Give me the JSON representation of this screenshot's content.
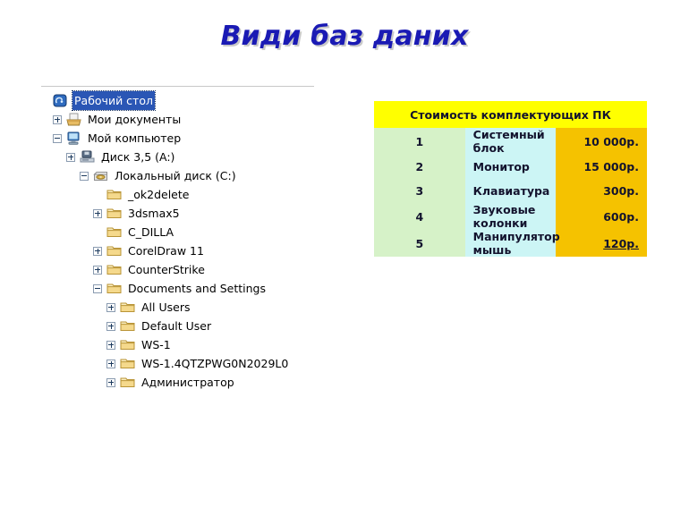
{
  "slide": {
    "title": "Види баз даних",
    "title_color": "#1a1ab4"
  },
  "explorer": {
    "name": "windows-explorer-folder-tree",
    "nodes": [
      {
        "label": "Рабочий стол",
        "level": 0,
        "toggle": "none",
        "icon": "desktop-icon",
        "selected": true
      },
      {
        "label": "Мои документы",
        "level": 1,
        "toggle": "plus",
        "icon": "my-documents-icon",
        "selected": false
      },
      {
        "label": "Мой компьютер",
        "level": 1,
        "toggle": "minus",
        "icon": "my-computer-icon",
        "selected": false
      },
      {
        "label": "Диск 3,5 (A:)",
        "level": 2,
        "toggle": "plus",
        "icon": "floppy-drive-icon",
        "selected": false
      },
      {
        "label": "Локальный диск (C:)",
        "level": 3,
        "toggle": "minus",
        "icon": "hard-drive-icon",
        "selected": false
      },
      {
        "label": "_ok2delete",
        "level": 4,
        "toggle": "none",
        "icon": "folder-icon",
        "selected": false
      },
      {
        "label": "3dsmax5",
        "level": 4,
        "toggle": "plus",
        "icon": "folder-icon",
        "selected": false
      },
      {
        "label": "C_DILLA",
        "level": 4,
        "toggle": "none",
        "icon": "folder-icon",
        "selected": false
      },
      {
        "label": "CorelDraw 11",
        "level": 4,
        "toggle": "plus",
        "icon": "folder-icon",
        "selected": false
      },
      {
        "label": "CounterStrike",
        "level": 4,
        "toggle": "plus",
        "icon": "folder-icon",
        "selected": false
      },
      {
        "label": "Documents and Settings",
        "level": 4,
        "toggle": "minus",
        "icon": "folder-icon",
        "selected": false
      },
      {
        "label": "All Users",
        "level": 5,
        "toggle": "plus",
        "icon": "folder-icon",
        "selected": false
      },
      {
        "label": "Default User",
        "level": 5,
        "toggle": "plus",
        "icon": "folder-icon",
        "selected": false
      },
      {
        "label": "WS-1",
        "level": 5,
        "toggle": "plus",
        "icon": "folder-icon",
        "selected": false
      },
      {
        "label": "WS-1.4QTZPWG0N2029L0",
        "level": 5,
        "toggle": "plus",
        "icon": "folder-icon",
        "selected": false
      },
      {
        "label": "Администратор",
        "level": 5,
        "toggle": "plus",
        "icon": "folder-icon",
        "selected": false
      }
    ]
  },
  "price_table": {
    "header": "Стоимость комплектующих ПК",
    "header_bg": "#ffff00",
    "num_col_bg": "#d6f2c8",
    "name_col_bg": "#ccf5f5",
    "price_col_bg": "#f5c200",
    "rows": [
      {
        "num": "1",
        "name": "Системный блок",
        "price": "10 000р.",
        "underline": false
      },
      {
        "num": "2",
        "name": "Монитор",
        "price": "15 000р.",
        "underline": false
      },
      {
        "num": "3",
        "name": "Клавиатура",
        "price": "300р.",
        "underline": false
      },
      {
        "num": "4",
        "name": "Звуковые колонки",
        "price": "600р.",
        "underline": false
      },
      {
        "num": "5",
        "name": "Манипулятор мышь",
        "price": "120р.",
        "underline": true
      }
    ]
  }
}
